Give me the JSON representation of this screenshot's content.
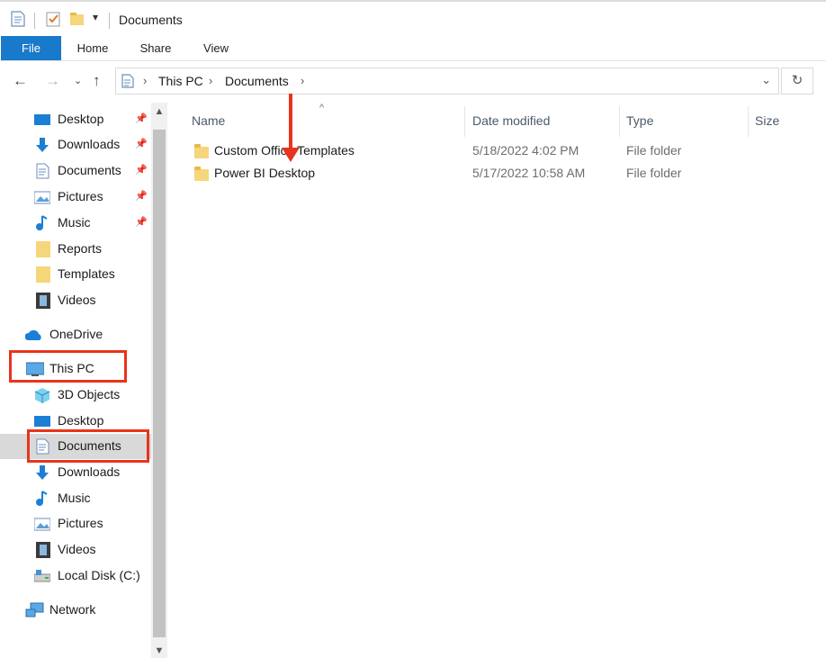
{
  "window": {
    "title": "Documents"
  },
  "ribbon": {
    "tabs": [
      "File",
      "Home",
      "Share",
      "View"
    ]
  },
  "address": {
    "crumbs": [
      "This PC",
      "Documents"
    ]
  },
  "nav": {
    "quick_access": [
      {
        "label": "Desktop",
        "icon": "desktop-icon",
        "pinned": true
      },
      {
        "label": "Downloads",
        "icon": "downloads-icon",
        "pinned": true
      },
      {
        "label": "Documents",
        "icon": "documents-icon",
        "pinned": true
      },
      {
        "label": "Pictures",
        "icon": "pictures-icon",
        "pinned": true
      },
      {
        "label": "Music",
        "icon": "music-icon",
        "pinned": true
      },
      {
        "label": "Reports",
        "icon": "folder-icon",
        "pinned": false
      },
      {
        "label": "Templates",
        "icon": "folder-icon",
        "pinned": false
      },
      {
        "label": "Videos",
        "icon": "videos-icon",
        "pinned": false
      }
    ],
    "onedrive": "OneDrive",
    "this_pc": "This PC",
    "this_pc_items": [
      {
        "label": "3D Objects",
        "icon": "3d-objects-icon"
      },
      {
        "label": "Desktop",
        "icon": "desktop-icon"
      },
      {
        "label": "Documents",
        "icon": "documents-icon",
        "selected": true
      },
      {
        "label": "Downloads",
        "icon": "downloads-icon"
      },
      {
        "label": "Music",
        "icon": "music-icon"
      },
      {
        "label": "Pictures",
        "icon": "pictures-icon"
      },
      {
        "label": "Videos",
        "icon": "videos-icon"
      },
      {
        "label": "Local Disk (C:)",
        "icon": "local-disk-icon"
      }
    ],
    "network": "Network"
  },
  "columns": {
    "name": "Name",
    "date": "Date modified",
    "type": "Type",
    "size": "Size"
  },
  "files": [
    {
      "name": "Custom Office Templates",
      "date": "5/18/2022 4:02 PM",
      "type": "File folder"
    },
    {
      "name": "Power BI Desktop",
      "date": "5/17/2022 10:58 AM",
      "type": "File folder"
    }
  ],
  "colors": {
    "accent": "#1979ca",
    "annotation": "#e8341c",
    "folder": "#f6d67a",
    "selected": "#d9d9d9"
  }
}
